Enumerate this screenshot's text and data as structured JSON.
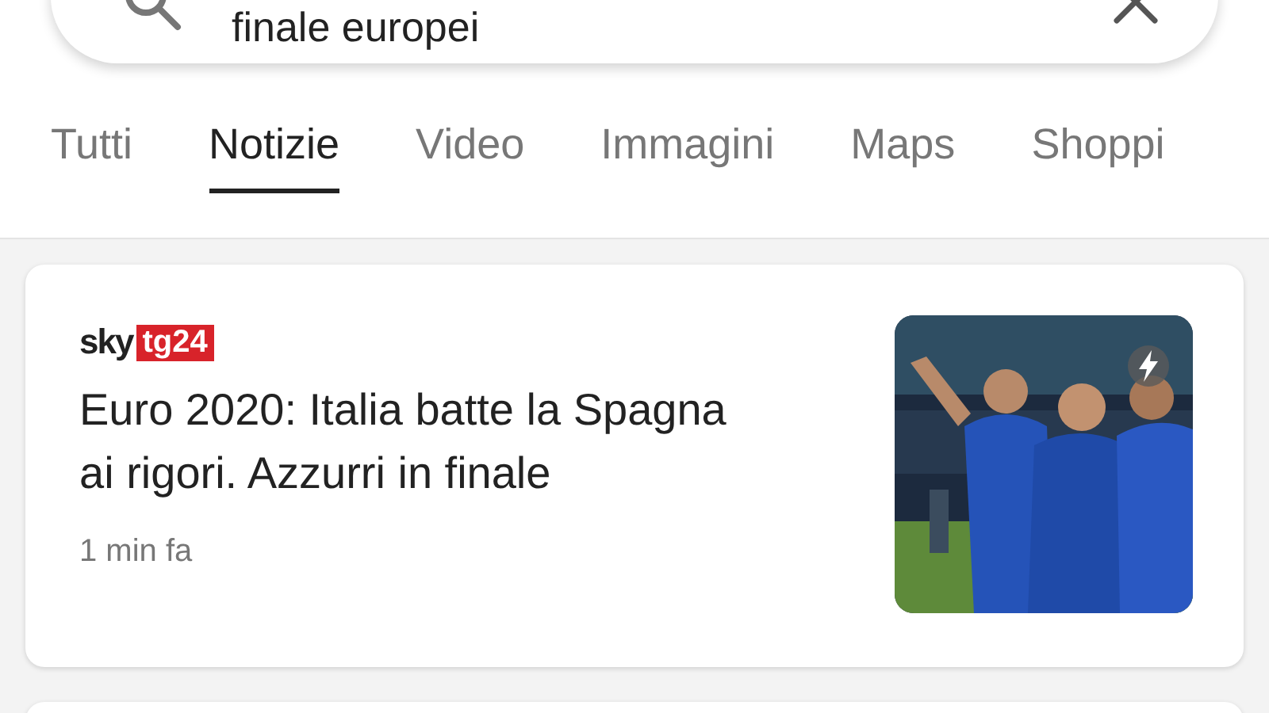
{
  "search": {
    "value": "finale europei"
  },
  "tabs": [
    {
      "label": "Tutti",
      "selected": false
    },
    {
      "label": "Notizie",
      "selected": true
    },
    {
      "label": "Video",
      "selected": false
    },
    {
      "label": "Immagini",
      "selected": false
    },
    {
      "label": "Maps",
      "selected": false
    },
    {
      "label": "Shoppi",
      "selected": false
    }
  ],
  "articles": [
    {
      "source": {
        "name": "sky",
        "badge": "tg24"
      },
      "headline": "Euro 2020: Italia batte la Spagna ai rigori. Azzurri in finale",
      "time": "1 min fa",
      "thumbnail": {
        "kind": "picture",
        "amp": true
      }
    }
  ]
}
